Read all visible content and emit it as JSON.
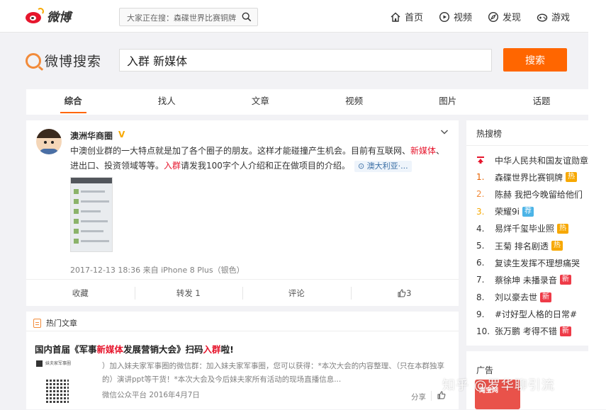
{
  "topbar": {
    "logo_text": "微博",
    "search_placeholder": "大家正在搜：森碟世界比赛铜牌",
    "nav": [
      {
        "label": "首页",
        "icon": "home-icon"
      },
      {
        "label": "视频",
        "icon": "video-icon"
      },
      {
        "label": "发现",
        "icon": "discover-icon"
      },
      {
        "label": "游戏",
        "icon": "game-icon"
      }
    ]
  },
  "search": {
    "logo_text": "微博搜索",
    "query": "入群 新媒体",
    "button_label": "搜索"
  },
  "tabs": [
    "综合",
    "找人",
    "文章",
    "视频",
    "图片",
    "话题"
  ],
  "post": {
    "username": "澳洲华商圈",
    "verified": "V",
    "text_1": "中澳创业群的一大特点就是加了各个圈子的朋友。这样才能碰撞产生机会。目前有互联网、",
    "text_hl1": "新媒体",
    "text_2": "、进出口、投资领域等等。",
    "text_hl2": "入群",
    "text_3": "请发我100字个人介绍和正在做项目的介绍。",
    "location": "澳大利亚·...",
    "meta": "2017-12-13 18:36 来自 iPhone 8 Plus（银色）",
    "actions": {
      "favorite": "收藏",
      "repost": "转发 1",
      "comment": "评论",
      "like": "3"
    }
  },
  "hot_article": {
    "section_label": "热门文章",
    "title_1": "国内首届《军事",
    "title_hl1": "新媒体",
    "title_2": "发展营销大会》扫码",
    "title_hl2": "入群",
    "title_3": "啦!",
    "thumb_caption": "妹夫家军事圈",
    "desc": "）加入妹夫家军事圈的微信群：加入妹夫家军事圈，您可以获得：*本次大会的内容整理、（只在本群独享的）演讲ppt等干货！*本次大会及今后妹夫家所有活动的现场直播信息...",
    "meta": "微信公众平台  2016年4月7日",
    "share": "分享"
  },
  "sidebar": {
    "title": "热搜榜",
    "items": [
      {
        "rank": "",
        "text": "中华人民共和国友谊勋章",
        "tag": ""
      },
      {
        "rank": "1.",
        "text": "森碟世界比赛铜牌",
        "tag": "热"
      },
      {
        "rank": "2.",
        "text": "陈赫 我把今晚留给他们",
        "tag": ""
      },
      {
        "rank": "3.",
        "text": "荣耀9i",
        "tag": "荐"
      },
      {
        "rank": "4.",
        "text": "易烊千玺毕业照",
        "tag": "热"
      },
      {
        "rank": "5.",
        "text": "王菊 排名剧透",
        "tag": "热"
      },
      {
        "rank": "6.",
        "text": "复读生发挥不理想痛哭",
        "tag": ""
      },
      {
        "rank": "7.",
        "text": "蔡徐坤 未播录音",
        "tag": "新"
      },
      {
        "rank": "8.",
        "text": "刘以豪去世",
        "tag": "新"
      },
      {
        "rank": "9.",
        "text": "#讨好型人格的日常#",
        "tag": ""
      },
      {
        "rank": "10.",
        "text": "张万鹏 考得不错",
        "tag": "新"
      }
    ]
  },
  "ad": {
    "title": "广告",
    "image_text": "淘宝网"
  },
  "watermark": "知乎 @罗华聊引流",
  "colors": {
    "accent": "#ff6600",
    "highlight": "#e6162d",
    "hot_tag": "#f7a800",
    "new_tag": "#ee3b48",
    "rec_tag": "#4cb4e7"
  }
}
